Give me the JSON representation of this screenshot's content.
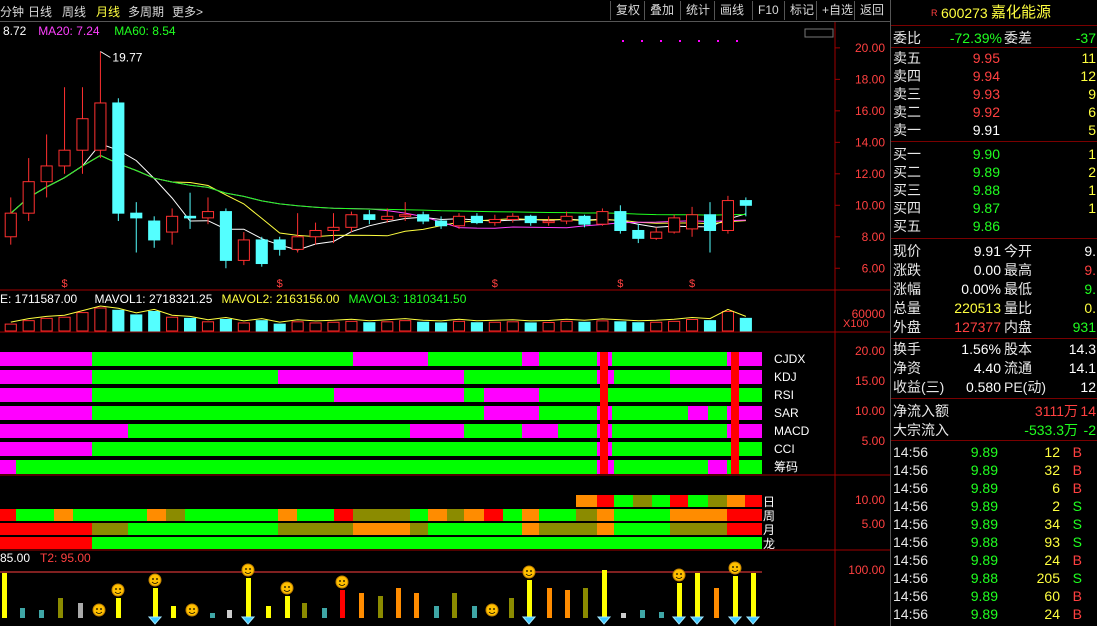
{
  "toolbar": {
    "tabs": [
      "分钟",
      "日线",
      "周线",
      "月线",
      "多周期",
      "更多>"
    ],
    "active_tab": "月线",
    "buttons": [
      "复权",
      "叠加",
      "统计",
      "画线",
      "F10",
      "标记",
      "+自选",
      "返回"
    ]
  },
  "price_panel": {
    "ma_legend": [
      {
        "label": "8.72",
        "color": "#ffffff"
      },
      {
        "label": "MA20: 7.24",
        "color": "#ff40ff"
      },
      {
        "label": "MA60: 8.54",
        "color": "#20ff20"
      }
    ],
    "high_label": "19.77",
    "y_ticks": [
      "20.00",
      "18.00",
      "16.00",
      "14.00",
      "12.00",
      "10.00",
      "8.00",
      "6.00"
    ],
    "candles": [
      {
        "o": 8.0,
        "c": 9.5,
        "h": 10.5,
        "l": 7.5
      },
      {
        "o": 9.5,
        "c": 11.5,
        "h": 13.0,
        "l": 9.0
      },
      {
        "o": 11.5,
        "c": 12.5,
        "h": 14.5,
        "l": 10.5
      },
      {
        "o": 12.5,
        "c": 13.5,
        "h": 17.5,
        "l": 12.0
      },
      {
        "o": 13.5,
        "c": 15.5,
        "h": 17.5,
        "l": 12.0
      },
      {
        "o": 13.5,
        "c": 16.5,
        "h": 19.77,
        "l": 13.0
      },
      {
        "o": 16.5,
        "c": 9.5,
        "h": 16.8,
        "l": 9.0
      },
      {
        "o": 9.5,
        "c": 9.2,
        "h": 10.2,
        "l": 7.0
      },
      {
        "o": 9.0,
        "c": 7.8,
        "h": 9.3,
        "l": 7.3
      },
      {
        "o": 8.3,
        "c": 9.3,
        "h": 9.8,
        "l": 7.5
      },
      {
        "o": 9.3,
        "c": 9.2,
        "h": 10.8,
        "l": 8.5
      },
      {
        "o": 9.2,
        "c": 9.6,
        "h": 10.5,
        "l": 8.8
      },
      {
        "o": 9.6,
        "c": 6.5,
        "h": 9.8,
        "l": 6.0
      },
      {
        "o": 6.5,
        "c": 7.8,
        "h": 8.3,
        "l": 6.2
      },
      {
        "o": 7.8,
        "c": 6.3,
        "h": 8.0,
        "l": 6.1
      },
      {
        "o": 7.8,
        "c": 7.2,
        "h": 8.0,
        "l": 6.8
      },
      {
        "o": 7.2,
        "c": 8.0,
        "h": 9.5,
        "l": 7.0
      },
      {
        "o": 8.0,
        "c": 8.4,
        "h": 8.9,
        "l": 7.5
      },
      {
        "o": 8.4,
        "c": 8.6,
        "h": 9.5,
        "l": 7.6
      },
      {
        "o": 8.6,
        "c": 9.4,
        "h": 9.6,
        "l": 8.3
      },
      {
        "o": 9.4,
        "c": 9.1,
        "h": 9.7,
        "l": 8.8
      },
      {
        "o": 9.1,
        "c": 9.3,
        "h": 9.8,
        "l": 8.9
      },
      {
        "o": 9.3,
        "c": 9.4,
        "h": 10.2,
        "l": 9.0
      },
      {
        "o": 9.4,
        "c": 9.0,
        "h": 9.6,
        "l": 8.8
      },
      {
        "o": 9.0,
        "c": 8.7,
        "h": 9.3,
        "l": 8.5
      },
      {
        "o": 8.7,
        "c": 9.3,
        "h": 9.5,
        "l": 8.5
      },
      {
        "o": 9.3,
        "c": 8.9,
        "h": 9.5,
        "l": 8.8
      },
      {
        "o": 8.9,
        "c": 9.1,
        "h": 9.4,
        "l": 8.7
      },
      {
        "o": 9.1,
        "c": 9.3,
        "h": 9.5,
        "l": 8.9
      },
      {
        "o": 9.3,
        "c": 8.9,
        "h": 9.4,
        "l": 8.7
      },
      {
        "o": 8.9,
        "c": 9.0,
        "h": 9.3,
        "l": 8.7
      },
      {
        "o": 9.0,
        "c": 9.3,
        "h": 9.6,
        "l": 8.8
      },
      {
        "o": 9.3,
        "c": 8.8,
        "h": 9.4,
        "l": 8.6
      },
      {
        "o": 8.8,
        "c": 9.6,
        "h": 9.8,
        "l": 8.7
      },
      {
        "o": 9.6,
        "c": 8.4,
        "h": 10.0,
        "l": 8.2
      },
      {
        "o": 8.4,
        "c": 7.9,
        "h": 8.8,
        "l": 7.6
      },
      {
        "o": 7.9,
        "c": 8.3,
        "h": 8.6,
        "l": 7.8
      },
      {
        "o": 8.3,
        "c": 9.2,
        "h": 9.4,
        "l": 8.2
      },
      {
        "o": 8.5,
        "c": 9.4,
        "h": 9.9,
        "l": 8.0
      },
      {
        "o": 9.4,
        "c": 8.4,
        "h": 10.2,
        "l": 7.0
      },
      {
        "o": 8.4,
        "c": 10.3,
        "h": 10.6,
        "l": 8.2
      },
      {
        "o": 10.3,
        "c": 10.0,
        "h": 10.5,
        "l": 9.3
      }
    ],
    "signal_marks": [
      3,
      15,
      27,
      34,
      38
    ]
  },
  "volume_panel": {
    "legend": [
      {
        "label": "E: 1711587.00",
        "color": "#ffffff"
      },
      {
        "label": "MAVOL1: 2718321.25",
        "color": "#ffffff"
      },
      {
        "label": "MAVOL2: 2163156.00",
        "color": "#ffff40"
      },
      {
        "label": "MAVOL3: 1810341.50",
        "color": "#20ff20"
      }
    ],
    "y_tick": "60000",
    "scale_label": "X100",
    "values": [
      30,
      45,
      55,
      60,
      80,
      100,
      90,
      70,
      85,
      60,
      55,
      40,
      50,
      35,
      45,
      30,
      40,
      35,
      38,
      42,
      36,
      40,
      45,
      38,
      35,
      42,
      36,
      38,
      40,
      35,
      37,
      42,
      38,
      44,
      40,
      36,
      38,
      42,
      50,
      45,
      85,
      55
    ]
  },
  "signal_panel": {
    "labels": [
      "CJDX",
      "KDJ",
      "RSI",
      "SAR",
      "MACD",
      "CCI",
      "筹码"
    ],
    "y_ticks": [
      "20.00",
      "15.00",
      "10.00",
      "5.00"
    ],
    "rows": [
      [
        [
          0,
          92,
          "#ff00ff"
        ],
        [
          92,
          353,
          "#00ff00"
        ],
        [
          353,
          428,
          "#ff00ff"
        ],
        [
          428,
          522,
          "#00ff00"
        ],
        [
          522,
          539,
          "#ff00ff"
        ],
        [
          539,
          597,
          "#00ff00"
        ],
        [
          597,
          612,
          "#ff00ff"
        ],
        [
          612,
          727,
          "#00ff00"
        ],
        [
          727,
          738,
          "#ff00ff"
        ],
        [
          738,
          762,
          "#ff00ff"
        ]
      ],
      [
        [
          0,
          92,
          "#ff00ff"
        ],
        [
          92,
          278,
          "#00ff00"
        ],
        [
          278,
          464,
          "#ff00ff"
        ],
        [
          464,
          597,
          "#00ff00"
        ],
        [
          597,
          614,
          "#ff00ff"
        ],
        [
          614,
          670,
          "#00ff00"
        ],
        [
          670,
          762,
          "#ff00ff"
        ]
      ],
      [
        [
          0,
          92,
          "#ff00ff"
        ],
        [
          92,
          334,
          "#00ff00"
        ],
        [
          334,
          464,
          "#ff00ff"
        ],
        [
          464,
          484,
          "#00ff00"
        ],
        [
          484,
          539,
          "#ff00ff"
        ],
        [
          539,
          762,
          "#00ff00"
        ]
      ],
      [
        [
          0,
          92,
          "#ff00ff"
        ],
        [
          92,
          484,
          "#00ff00"
        ],
        [
          484,
          539,
          "#ff00ff"
        ],
        [
          539,
          597,
          "#00ff00"
        ],
        [
          597,
          612,
          "#ff00ff"
        ],
        [
          612,
          688,
          "#00ff00"
        ],
        [
          688,
          708,
          "#ff00ff"
        ],
        [
          708,
          727,
          "#00ff00"
        ],
        [
          727,
          762,
          "#ff00ff"
        ]
      ],
      [
        [
          0,
          128,
          "#ff00ff"
        ],
        [
          128,
          410,
          "#00ff00"
        ],
        [
          410,
          464,
          "#ff00ff"
        ],
        [
          464,
          522,
          "#00ff00"
        ],
        [
          522,
          558,
          "#ff00ff"
        ],
        [
          558,
          597,
          "#00ff00"
        ],
        [
          597,
          612,
          "#ff00ff"
        ],
        [
          612,
          727,
          "#00ff00"
        ],
        [
          727,
          762,
          "#ff00ff"
        ]
      ],
      [
        [
          0,
          92,
          "#ff00ff"
        ],
        [
          92,
          597,
          "#00ff00"
        ],
        [
          597,
          612,
          "#ff00ff"
        ],
        [
          612,
          762,
          "#00ff00"
        ]
      ],
      [
        [
          0,
          16,
          "#ff00ff"
        ],
        [
          16,
          597,
          "#00ff00"
        ],
        [
          597,
          614,
          "#ff00ff"
        ],
        [
          614,
          708,
          "#00ff00"
        ],
        [
          708,
          727,
          "#ff00ff"
        ],
        [
          727,
          762,
          "#00ff00"
        ]
      ]
    ],
    "red_markers": [
      600,
      731
    ]
  },
  "period_panel": {
    "labels": [
      "日",
      "周",
      "月",
      "龙"
    ],
    "y_ticks": [
      "10.00",
      "5.00"
    ],
    "rows": [
      [
        [
          576,
          597,
          "#ff8c00"
        ],
        [
          597,
          614,
          "#ff0000"
        ],
        [
          614,
          633,
          "#00ff00"
        ],
        [
          633,
          652,
          "#8b8b00"
        ],
        [
          652,
          670,
          "#00ff00"
        ],
        [
          670,
          688,
          "#ff0000"
        ],
        [
          688,
          708,
          "#00ff00"
        ],
        [
          708,
          727,
          "#8b8b00"
        ],
        [
          727,
          745,
          "#ff8c00"
        ],
        [
          745,
          762,
          "#ff0000"
        ]
      ],
      [
        [
          0,
          16,
          "#ff0000"
        ],
        [
          16,
          54,
          "#00ff00"
        ],
        [
          54,
          73,
          "#ff8c00"
        ],
        [
          73,
          147,
          "#00ff00"
        ],
        [
          147,
          166,
          "#ff8c00"
        ],
        [
          166,
          185,
          "#8b8b00"
        ],
        [
          185,
          278,
          "#00ff00"
        ],
        [
          278,
          297,
          "#ff8c00"
        ],
        [
          297,
          334,
          "#00ff00"
        ],
        [
          334,
          353,
          "#ff0000"
        ],
        [
          353,
          410,
          "#8b8b00"
        ],
        [
          410,
          428,
          "#00ff00"
        ],
        [
          428,
          447,
          "#ff8c00"
        ],
        [
          447,
          464,
          "#8b8b00"
        ],
        [
          464,
          484,
          "#ff8c00"
        ],
        [
          484,
          503,
          "#ff0000"
        ],
        [
          503,
          522,
          "#00ff00"
        ],
        [
          522,
          539,
          "#ff8c00"
        ],
        [
          539,
          576,
          "#00ff00"
        ],
        [
          576,
          597,
          "#8b8b00"
        ],
        [
          597,
          614,
          "#ff8c00"
        ],
        [
          614,
          670,
          "#00ff00"
        ],
        [
          670,
          727,
          "#ff8c00"
        ],
        [
          727,
          762,
          "#ff0000"
        ]
      ],
      [
        [
          0,
          92,
          "#ff0000"
        ],
        [
          92,
          128,
          "#8b8b00"
        ],
        [
          128,
          278,
          "#00ff00"
        ],
        [
          278,
          353,
          "#8b8b00"
        ],
        [
          353,
          410,
          "#ff8c00"
        ],
        [
          410,
          428,
          "#8b8b00"
        ],
        [
          428,
          522,
          "#00ff00"
        ],
        [
          522,
          539,
          "#ff8c00"
        ],
        [
          539,
          597,
          "#8b8b00"
        ],
        [
          597,
          614,
          "#ff8c00"
        ],
        [
          614,
          670,
          "#00ff00"
        ],
        [
          670,
          727,
          "#8b8b00"
        ],
        [
          727,
          762,
          "#ff0000"
        ]
      ],
      [
        [
          0,
          92,
          "#ff0000"
        ],
        [
          92,
          762,
          "#00ff00"
        ]
      ]
    ]
  },
  "bottom_panel": {
    "legend": [
      {
        "label": "85.00",
        "color": "#ffffff"
      },
      {
        "label": "T2: 95.00",
        "color": "#ff4040"
      }
    ],
    "y_tick": "100.00",
    "bars": [
      {
        "x": 4,
        "h": 45,
        "c": "#ffff00"
      },
      {
        "x": 22,
        "h": 10,
        "c": "#3fa6a6"
      },
      {
        "x": 41,
        "h": 8,
        "c": "#3fa6a6"
      },
      {
        "x": 60,
        "h": 20,
        "c": "#8b8b00"
      },
      {
        "x": 80,
        "h": 15,
        "c": "#aaaaaa"
      },
      {
        "x": 118,
        "h": 20,
        "c": "#ffff00"
      },
      {
        "x": 155,
        "h": 30,
        "c": "#ffff00"
      },
      {
        "x": 173,
        "h": 12,
        "c": "#ffff00"
      },
      {
        "x": 212,
        "h": 5,
        "c": "#3fa6a6"
      },
      {
        "x": 229,
        "h": 8,
        "c": "#cccccc"
      },
      {
        "x": 248,
        "h": 40,
        "c": "#ffff00"
      },
      {
        "x": 268,
        "h": 12,
        "c": "#ffff00"
      },
      {
        "x": 287,
        "h": 22,
        "c": "#ffff00"
      },
      {
        "x": 304,
        "h": 15,
        "c": "#8b8b00"
      },
      {
        "x": 324,
        "h": 10,
        "c": "#3fa6a6"
      },
      {
        "x": 342,
        "h": 28,
        "c": "#ff0000"
      },
      {
        "x": 361,
        "h": 25,
        "c": "#ff8c00"
      },
      {
        "x": 380,
        "h": 22,
        "c": "#8b8b00"
      },
      {
        "x": 398,
        "h": 30,
        "c": "#ff8c00"
      },
      {
        "x": 416,
        "h": 25,
        "c": "#ff8c00"
      },
      {
        "x": 436,
        "h": 12,
        "c": "#3fa6a6"
      },
      {
        "x": 454,
        "h": 25,
        "c": "#8b8b00"
      },
      {
        "x": 474,
        "h": 12,
        "c": "#3fa6a6"
      },
      {
        "x": 511,
        "h": 20,
        "c": "#8b8b00"
      },
      {
        "x": 529,
        "h": 38,
        "c": "#ffff00"
      },
      {
        "x": 549,
        "h": 30,
        "c": "#ff8c00"
      },
      {
        "x": 567,
        "h": 28,
        "c": "#ff8c00"
      },
      {
        "x": 585,
        "h": 30,
        "c": "#8b8b00"
      },
      {
        "x": 604,
        "h": 48,
        "c": "#ffff00"
      },
      {
        "x": 623,
        "h": 5,
        "c": "#cccccc"
      },
      {
        "x": 642,
        "h": 8,
        "c": "#3fa6a6"
      },
      {
        "x": 661,
        "h": 6,
        "c": "#3fa6a6"
      },
      {
        "x": 679,
        "h": 35,
        "c": "#ffff00"
      },
      {
        "x": 697,
        "h": 45,
        "c": "#ffff00"
      },
      {
        "x": 716,
        "h": 30,
        "c": "#ff8c00"
      },
      {
        "x": 735,
        "h": 42,
        "c": "#ffff00"
      },
      {
        "x": 753,
        "h": 45,
        "c": "#ffff00"
      }
    ],
    "faces": [
      99,
      118,
      155,
      192,
      248,
      287,
      342,
      492,
      529,
      679,
      735
    ],
    "diamonds": [
      155,
      248,
      529,
      604,
      679,
      697,
      735,
      753
    ]
  },
  "quote": {
    "code_prefix": "R",
    "code": "600273",
    "name": "嘉化能源",
    "weibi_label": "委比",
    "weibi": "-72.39%",
    "weicha_label": "委差",
    "weicha": "-37",
    "asks": [
      {
        "label": "卖五",
        "price": "9.95",
        "vol": "11"
      },
      {
        "label": "卖四",
        "price": "9.94",
        "vol": "12"
      },
      {
        "label": "卖三",
        "price": "9.93",
        "vol": "9"
      },
      {
        "label": "卖二",
        "price": "9.92",
        "vol": "6"
      },
      {
        "label": "卖一",
        "price": "9.91",
        "vol": "5"
      }
    ],
    "bids": [
      {
        "label": "买一",
        "price": "9.90",
        "vol": "1"
      },
      {
        "label": "买二",
        "price": "9.89",
        "vol": "2"
      },
      {
        "label": "买三",
        "price": "9.88",
        "vol": "1"
      },
      {
        "label": "买四",
        "price": "9.87",
        "vol": "1"
      },
      {
        "label": "买五",
        "price": "9.86",
        "vol": ""
      }
    ],
    "stats1": [
      {
        "l1": "现价",
        "v1": "9.91",
        "c1": "white",
        "l2": "今开",
        "v2": "9.",
        "c2": "white"
      },
      {
        "l1": "涨跌",
        "v1": "0.00",
        "c1": "white",
        "l2": "最高",
        "v2": "9.",
        "c2": "red"
      },
      {
        "l1": "涨幅",
        "v1": "0.00%",
        "c1": "white",
        "l2": "最低",
        "v2": "9.",
        "c2": "green"
      },
      {
        "l1": "总量",
        "v1": "220513",
        "c1": "yellow",
        "l2": "量比",
        "v2": "0.",
        "c2": "yellow"
      },
      {
        "l1": "外盘",
        "v1": "127377",
        "c1": "red",
        "l2": "内盘",
        "v2": "931",
        "c2": "green"
      }
    ],
    "stats2": [
      {
        "l1": "换手",
        "v1": "1.56%",
        "c1": "white",
        "l2": "股本",
        "v2": "14.3",
        "c2": "white"
      },
      {
        "l1": "净资",
        "v1": "4.40",
        "c1": "white",
        "l2": "流通",
        "v2": "14.1",
        "c2": "white"
      },
      {
        "l1": "收益(三)",
        "v1": "0.580",
        "c1": "white",
        "l2": "PE(动)",
        "v2": "12",
        "c2": "white"
      }
    ],
    "flow": [
      {
        "label": "净流入额",
        "value": "3111万",
        "color": "red",
        "extra": "14"
      },
      {
        "label": "大宗流入",
        "value": "-533.3万",
        "color": "green",
        "extra": "-2"
      }
    ],
    "ticks": [
      {
        "time": "14:56",
        "price": "9.89",
        "vol": "12",
        "side": "B"
      },
      {
        "time": "14:56",
        "price": "9.89",
        "vol": "32",
        "side": "B"
      },
      {
        "time": "14:56",
        "price": "9.89",
        "vol": "6",
        "side": "B"
      },
      {
        "time": "14:56",
        "price": "9.89",
        "vol": "2",
        "side": "S"
      },
      {
        "time": "14:56",
        "price": "9.89",
        "vol": "34",
        "side": "S"
      },
      {
        "time": "14:56",
        "price": "9.88",
        "vol": "93",
        "side": "S"
      },
      {
        "time": "14:56",
        "price": "9.89",
        "vol": "24",
        "side": "B"
      },
      {
        "time": "14:56",
        "price": "9.88",
        "vol": "205",
        "side": "S"
      },
      {
        "time": "14:56",
        "price": "9.89",
        "vol": "60",
        "side": "B"
      },
      {
        "time": "14:56",
        "price": "9.89",
        "vol": "24",
        "side": "B"
      }
    ]
  }
}
